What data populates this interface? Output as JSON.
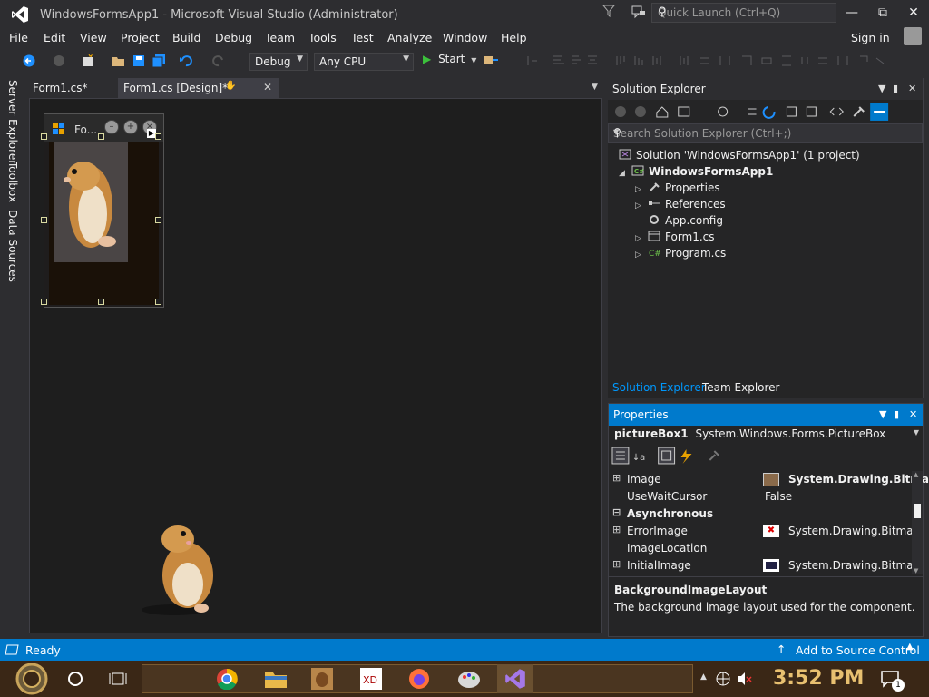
{
  "window": {
    "title": "WindowsFormsApp1 - Microsoft Visual Studio  (Administrator)",
    "quick_launch_placeholder": "Quick Launch (Ctrl+Q)",
    "sign_in": "Sign in"
  },
  "menu": [
    "File",
    "Edit",
    "View",
    "Project",
    "Build",
    "Debug",
    "Team",
    "Tools",
    "Test",
    "Analyze",
    "Window",
    "Help"
  ],
  "toolbar": {
    "config": "Debug",
    "platform": "Any CPU",
    "start": "Start"
  },
  "side_tabs": [
    "Server Explorer",
    "Toolbox",
    "Data Sources"
  ],
  "doc_tabs": [
    {
      "label": "Form1.cs*",
      "active": false
    },
    {
      "label": "Form1.cs [Design]*",
      "active": true
    }
  ],
  "form": {
    "title": "Fo..."
  },
  "solution_explorer": {
    "title": "Solution Explorer",
    "search_placeholder": "Search Solution Explorer (Ctrl+;)",
    "solution": "Solution 'WindowsFormsApp1' (1 project)",
    "project": "WindowsFormsApp1",
    "items": [
      "Properties",
      "References",
      "App.config",
      "Form1.cs",
      "Program.cs"
    ]
  },
  "bottom_tabs": [
    "Solution Explorer",
    "Team Explorer"
  ],
  "properties": {
    "title": "Properties",
    "object_name": "pictureBox1",
    "object_type": "System.Windows.Forms.PictureBox",
    "rows": [
      {
        "name": "Image",
        "value": "System.Drawing.Bitma",
        "expand": "⊞",
        "bold_value": true
      },
      {
        "name": "UseWaitCursor",
        "value": "False",
        "expand": "",
        "bold_value": false
      },
      {
        "name": "Asynchronous",
        "value": "",
        "expand": "⊟",
        "category": true
      },
      {
        "name": "ErrorImage",
        "value": "System.Drawing.Bitmap",
        "expand": "⊞",
        "bold_value": false
      },
      {
        "name": "ImageLocation",
        "value": "",
        "expand": "",
        "bold_value": false
      },
      {
        "name": "InitialImage",
        "value": "System.Drawing.Bitmap",
        "expand": "⊞",
        "bold_value": false
      }
    ],
    "desc_title": "BackgroundImageLayout",
    "desc_text": "The background image layout used for the component."
  },
  "status": {
    "left": "Ready",
    "right": "Add to Source Control"
  },
  "taskbar": {
    "time": "3:52 PM",
    "notif_count": "1"
  },
  "colors": {
    "accent": "#007acc",
    "bg": "#2d2d30",
    "designer": "#1e1e1e"
  }
}
